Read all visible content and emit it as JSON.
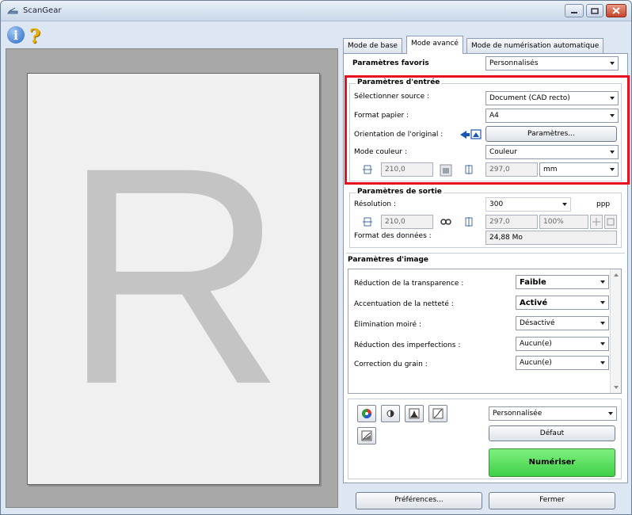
{
  "window": {
    "title": "ScanGear"
  },
  "tabs": [
    {
      "label": "Mode de base"
    },
    {
      "label": "Mode avancé"
    },
    {
      "label": "Mode de numérisation automatique"
    }
  ],
  "favorites": {
    "label": "Paramètres favoris",
    "value": "Personnalisés"
  },
  "input_settings": {
    "title": "Paramètres d'entrée",
    "source_label": "Sélectionner source :",
    "source_value": "Document (CAD recto)",
    "paper_label": "Format papier :",
    "paper_value": "A4",
    "orientation_label": "Orientation de l'original :",
    "orientation_button": "Paramètres...",
    "color_label": "Mode couleur :",
    "color_value": "Couleur",
    "width_value": "210,0",
    "height_value": "297,0",
    "unit_value": "mm"
  },
  "output_settings": {
    "title": "Paramètres de sortie",
    "resolution_label": "Résolution :",
    "resolution_value": "300",
    "resolution_unit": "ppp",
    "width_value": "210,0",
    "height_value": "297,0",
    "scale_value": "100%",
    "data_size_label": "Format des données :",
    "data_size_value": "24,88 Mo"
  },
  "image_settings": {
    "title": "Paramètres d'image",
    "rows": [
      {
        "label": "Réduction de la transparence :",
        "value": "Faible"
      },
      {
        "label": "Accentuation de la netteté :",
        "value": "Activé"
      },
      {
        "label": "Élimination moiré :",
        "value": "Désactivé"
      },
      {
        "label": "Réduction des imperfections :",
        "value": "Aucun(e)"
      },
      {
        "label": "Correction du grain :",
        "value": "Aucun(e)"
      }
    ]
  },
  "color_adjust": {
    "preset_value": "Personnalisée",
    "default_button": "Défaut"
  },
  "scan_button": "Numériser",
  "bottom": {
    "preferences": "Préférences...",
    "close": "Fermer"
  },
  "preview": {
    "letter": "R"
  },
  "colors": {
    "highlight": "#e8121f",
    "scan": "#4cd454",
    "preview_bg": "#a8a8a8"
  }
}
